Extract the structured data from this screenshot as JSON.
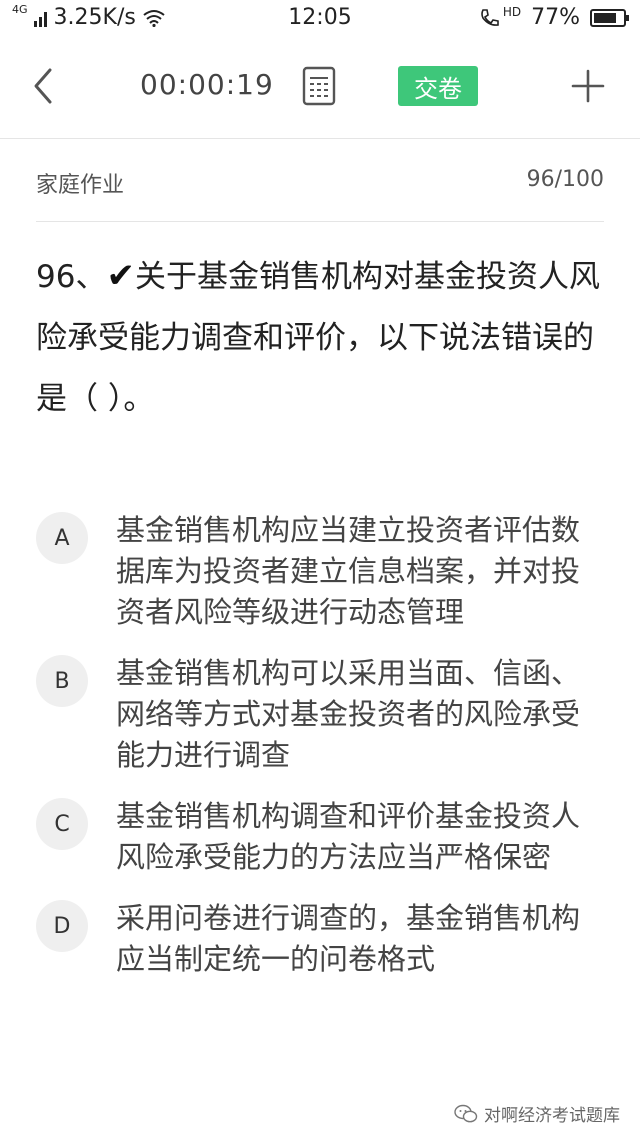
{
  "status_bar": {
    "network": "4G",
    "speed": "3.25K/s",
    "time": "12:05",
    "hd": "HD",
    "battery": "77%",
    "battery_level": 0.77
  },
  "header": {
    "timer": "00:00:19",
    "submit_label": "交卷"
  },
  "subheader": {
    "category": "家庭作业",
    "progress": "96/100"
  },
  "question": {
    "number": "96、",
    "mark": "✔",
    "text": "关于基金销售机构对基金投资人风险承受能力调查和评价，以下说法错误的是（ ）。"
  },
  "options": [
    {
      "letter": "A",
      "text": "基金销售机构应当建立投资者评估数据库为投资者建立信息档案，并对投资者风险等级进行动态管理"
    },
    {
      "letter": "B",
      "text": "基金销售机构可以采用当面、信函、网络等方式对基金投资者的风险承受能力进行调查"
    },
    {
      "letter": "C",
      "text": "基金销售机构调查和评价基金投资人风险承受能力的方法应当严格保密"
    },
    {
      "letter": "D",
      "text": "采用问卷进行调查的，基金销售机构应当制定统一的问卷格式"
    }
  ],
  "watermark": {
    "text": "对啊经济考试题库",
    "icon": "wechat-icon"
  }
}
